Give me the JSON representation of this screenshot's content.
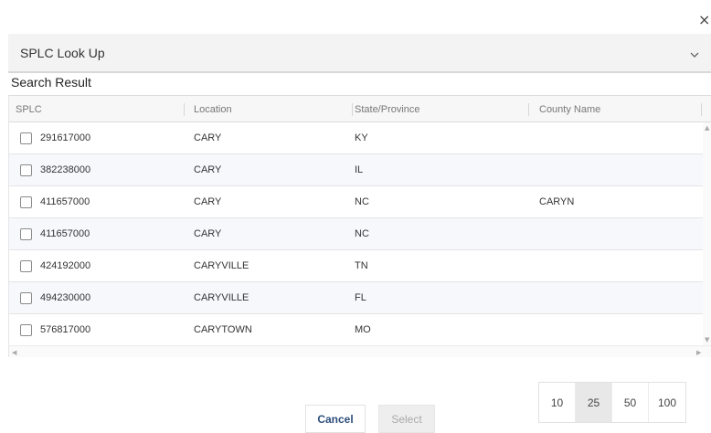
{
  "dialog": {
    "close_glyph": "×",
    "title": "SPLC Look Up",
    "section_label": "Search Result"
  },
  "table": {
    "columns": [
      "SPLC",
      "Location",
      "State/Province",
      "County Name"
    ],
    "rows": [
      {
        "splc": "291617000",
        "location": "CARY",
        "state": "KY",
        "county": ""
      },
      {
        "splc": "382238000",
        "location": "CARY",
        "state": "IL",
        "county": ""
      },
      {
        "splc": "411657000",
        "location": "CARY",
        "state": "NC",
        "county": "CARYN"
      },
      {
        "splc": "411657000",
        "location": "CARY",
        "state": "NC",
        "county": ""
      },
      {
        "splc": "424192000",
        "location": "CARYVILLE",
        "state": "TN",
        "county": ""
      },
      {
        "splc": "494230000",
        "location": "CARYVILLE",
        "state": "FL",
        "county": ""
      },
      {
        "splc": "576817000",
        "location": "CARYTOWN",
        "state": "MO",
        "county": ""
      }
    ]
  },
  "pager": {
    "sizes": [
      "10",
      "25",
      "50",
      "100"
    ],
    "selected": "25"
  },
  "actions": {
    "cancel_label": "Cancel",
    "select_label": "Select"
  },
  "colors": {
    "accent": "#2e4f7c",
    "header_bg": "#f3f3f3",
    "alt_row": "#f6f8fb"
  },
  "icons": [
    "close-icon",
    "chevron-down-icon",
    "checkbox-icon",
    "scroll-arrow-icon"
  ]
}
